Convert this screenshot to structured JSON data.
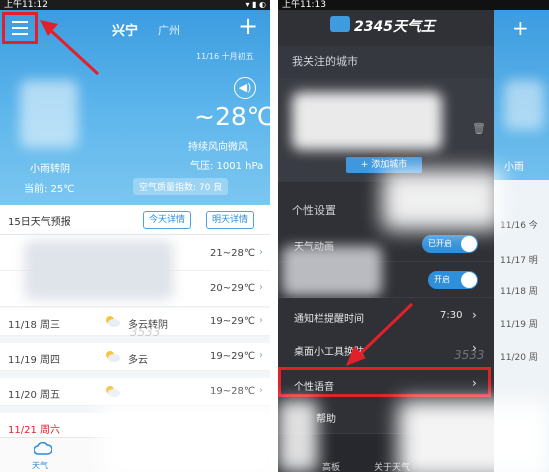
{
  "left": {
    "status_time": "上午11:12",
    "header": {
      "city": "兴宁",
      "sub_city": "广州",
      "date": "11/16 十月初五"
    },
    "current": {
      "temp_range": "~28℃",
      "wind": "持续风向微风",
      "pressure": "气压: 1001 hPa",
      "desc": "小雨转阴",
      "now_temp": "当前: 25℃",
      "aqi": "空气质量指数: 70 良"
    },
    "forecast": {
      "title": "15日天气预报",
      "today_btn": "今天详情",
      "tomorrow_btn": "明天详情",
      "rows": [
        {
          "date": "",
          "weather": "",
          "temp": "21~28℃"
        },
        {
          "date": "",
          "weather": "",
          "temp": "20~29℃"
        },
        {
          "date": "11/18 周三",
          "weather": "多云转阴",
          "temp": "19~29℃"
        },
        {
          "date": "11/19 周四",
          "weather": "多云",
          "temp": "19~29℃"
        },
        {
          "date": "11/20 周五",
          "weather": "",
          "temp": "19~28℃"
        },
        {
          "date": "11/21 周六",
          "weather": "",
          "temp": ""
        }
      ]
    },
    "nav": {
      "weather_label": "天气"
    },
    "watermark": "3533"
  },
  "right": {
    "status_time": "上午11:13",
    "logo_text": "2345天气王",
    "sections": {
      "followed": "我关注的城市",
      "personal": "个性设置"
    },
    "add_city": "+ 添加城市",
    "items": {
      "weather_anim": "天气动画",
      "weather_anim_state": "已开启",
      "second_toggle_state": "开启",
      "notify_time": "通知栏提醒时间",
      "notify_value": "7:30",
      "skin": "桌面小工具换肤",
      "voice": "个性语音",
      "help": "帮助"
    },
    "bottom": {
      "left_tab": "高板",
      "right_tab": "关于天气"
    },
    "side": {
      "desc": "小雨",
      "rows": [
        "11/16 今",
        "11/17 明",
        "11/18 周",
        "11/19 周",
        "11/20 周"
      ]
    },
    "watermark": "3533"
  },
  "colors": {
    "sky": "#3c9ce0",
    "accent_red": "#e2202a",
    "drawer_bg": "#2f3137",
    "toggle_on": "#2f8fdb"
  }
}
